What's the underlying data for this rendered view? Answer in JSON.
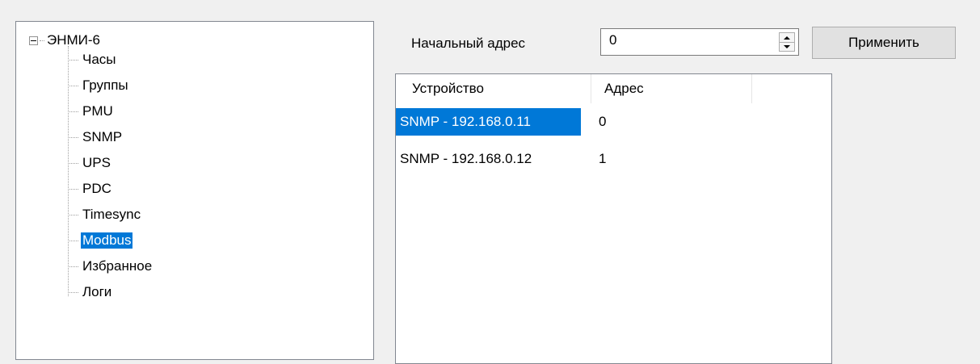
{
  "tree": {
    "root_label": "ЭНМИ-6",
    "items": [
      {
        "label": "Часы",
        "selected": false
      },
      {
        "label": "Группы",
        "selected": false
      },
      {
        "label": "PMU",
        "selected": false
      },
      {
        "label": "SNMP",
        "selected": false
      },
      {
        "label": "UPS",
        "selected": false
      },
      {
        "label": "PDC",
        "selected": false
      },
      {
        "label": "Timesync",
        "selected": false
      },
      {
        "label": "Modbus",
        "selected": true
      },
      {
        "label": "Избранное",
        "selected": false
      },
      {
        "label": "Логи",
        "selected": false
      }
    ]
  },
  "start_address": {
    "label": "Начальный адрес",
    "value": "0"
  },
  "apply_button": {
    "label": "Применить"
  },
  "device_list": {
    "columns": [
      "Устройство",
      "Адрес"
    ],
    "rows": [
      {
        "device": "SNMP - 192.168.0.11",
        "address": "0",
        "selected": true
      },
      {
        "device": "SNMP - 192.168.0.12",
        "address": "1",
        "selected": false
      }
    ]
  },
  "colors": {
    "selection": "#0078d7",
    "background": "#f0f0f0"
  }
}
